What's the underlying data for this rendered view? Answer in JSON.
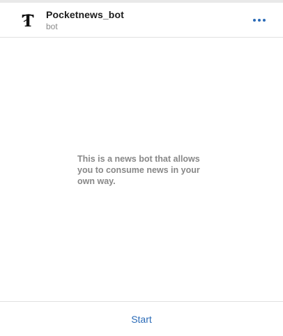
{
  "header": {
    "bot_name": "Pocketnews_bot",
    "bot_subtitle": "bot",
    "avatar_icon": "nyt-logo-icon",
    "more_icon": "more-dots-icon"
  },
  "main": {
    "description": "This is a news bot that allows you to consume news in your own way."
  },
  "footer": {
    "start_label": "Start"
  },
  "colors": {
    "accent": "#2b6bb7",
    "muted_text": "#888888",
    "title_text": "#1b1b1b",
    "divider": "#e1e1e1"
  }
}
